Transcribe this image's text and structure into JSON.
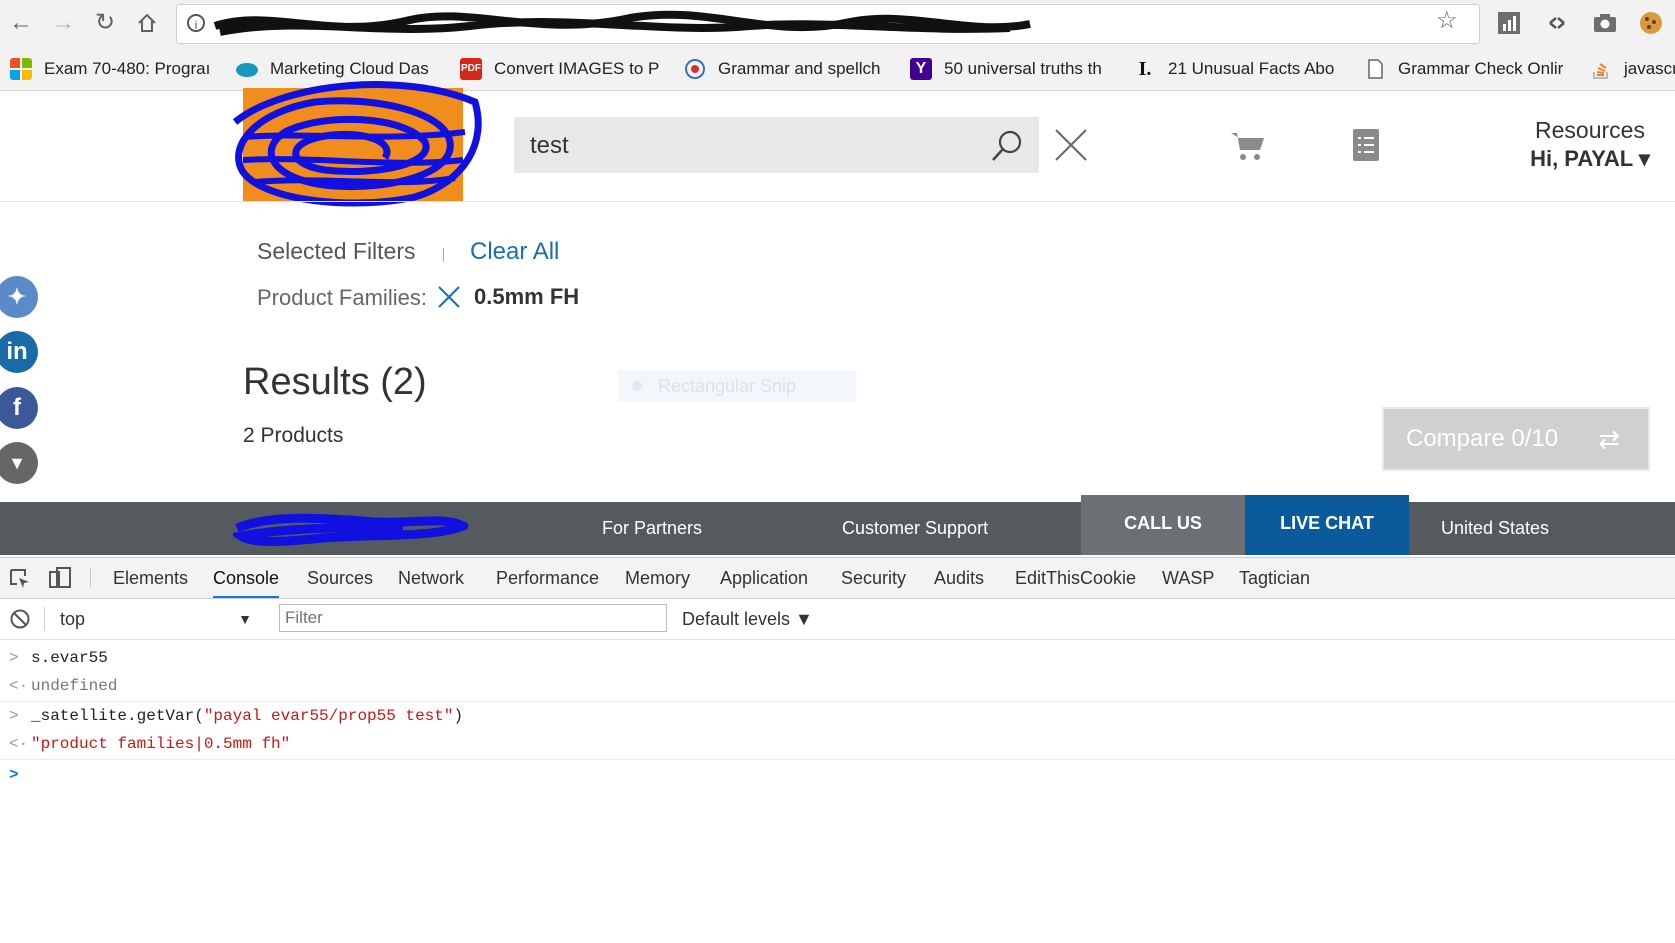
{
  "browser": {
    "url": "",
    "bookmarks": [
      {
        "label": "Exam 70-480: Prograı",
        "icon": "windows-icon"
      },
      {
        "label": "Marketing Cloud Das",
        "icon": "salesforce-cloud-icon"
      },
      {
        "label": "Convert IMAGES to P",
        "icon": "pdf-icon"
      },
      {
        "label": "Grammar and spellch",
        "icon": "grammar-icon"
      },
      {
        "label": "50 universal truths th",
        "icon": "yahoo-icon"
      },
      {
        "label": "21 Unusual Facts Abo",
        "icon": "inc-icon"
      },
      {
        "label": "Grammar Check Onlir",
        "icon": "document-icon"
      },
      {
        "label": "javascr",
        "icon": "stackoverflow-icon"
      }
    ]
  },
  "header": {
    "search_value": "test",
    "resources_label": "Resources",
    "user_greeting": "Hi, PAYAL ▾"
  },
  "filters": {
    "title": "Selected Filters",
    "clear_all": "Clear All",
    "label": "Product Families:",
    "value": "0.5mm FH"
  },
  "results": {
    "title": "Results (2)",
    "count": "2 Products",
    "snip_label": "Rectangular Snip",
    "compare_label": "Compare 0/10"
  },
  "footer_nav": {
    "partners": "For Partners",
    "support": "Customer Support",
    "call_us": "CALL US",
    "live_chat": "LIVE CHAT",
    "country": "United States"
  },
  "devtools": {
    "tabs": [
      "Elements",
      "Console",
      "Sources",
      "Network",
      "Performance",
      "Memory",
      "Application",
      "Security",
      "Audits",
      "EditThisCookie",
      "WASP",
      "Tagtician"
    ],
    "active_tab": "Console",
    "context": "top",
    "filter_placeholder": "Filter",
    "levels": "Default levels ▼",
    "console": {
      "cmd1": "s.evar55",
      "res1": "undefined",
      "cmd2_prefix": "_satellite.getVar(",
      "cmd2_arg": "\"payal evar55/prop55 test\"",
      "cmd2_suffix": ")",
      "res2": "\"product families|0.5mm fh\""
    }
  },
  "colors": {
    "accent_blue": "#1a6eb0",
    "live_chat": "#0b5a9c",
    "footer": "#555a5f",
    "logo_orange": "#f08d1c",
    "scribble": "#1010e0"
  }
}
